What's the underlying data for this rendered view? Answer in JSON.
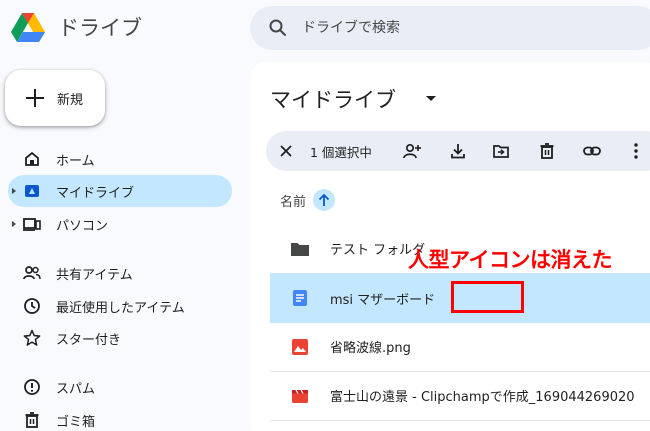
{
  "app": {
    "title": "ドライブ",
    "logo_icon": "google-drive-logo"
  },
  "search": {
    "placeholder": "ドライブで検索",
    "icon": "search-icon"
  },
  "sidebar": {
    "new_button": {
      "label": "新規",
      "icon": "plus-icon"
    },
    "items": [
      {
        "label": "ホーム",
        "icon": "home-icon",
        "active": false
      },
      {
        "label": "マイドライブ",
        "icon": "my-drive-icon",
        "active": true
      },
      {
        "label": "パソコン",
        "icon": "computer-icon",
        "active": false
      },
      {
        "label": "共有アイテム",
        "icon": "people-icon",
        "active": false
      },
      {
        "label": "最近使用したアイテム",
        "icon": "clock-icon",
        "active": false
      },
      {
        "label": "スター付き",
        "icon": "star-icon",
        "active": false
      },
      {
        "label": "スパム",
        "icon": "spam-icon",
        "active": false
      },
      {
        "label": "ゴミ箱",
        "icon": "trash-icon",
        "active": false
      }
    ]
  },
  "main": {
    "title": "マイドライブ",
    "selection_bar": {
      "count_label": "1 個選択中",
      "tools": [
        "add-person-icon",
        "download-icon",
        "move-to-folder-icon",
        "trash-icon",
        "link-icon",
        "more-vert-icon"
      ]
    },
    "column_header": "名前",
    "files": [
      {
        "name": "テスト フォルダ",
        "type": "folder",
        "selected": false
      },
      {
        "name": "msi マザーボード",
        "type": "doc",
        "selected": true
      },
      {
        "name": "省略波線.png",
        "type": "image",
        "selected": false
      },
      {
        "name": "富士山の遠景 - Clipchampで作成_169044269020",
        "type": "video",
        "selected": false
      }
    ]
  },
  "annotation": {
    "text": "人型アイコンは消えた",
    "color": "#ff0000"
  },
  "colors": {
    "accent": "#c2e7ff",
    "background": "#f8fafd",
    "search_bg": "#e9eef6"
  }
}
